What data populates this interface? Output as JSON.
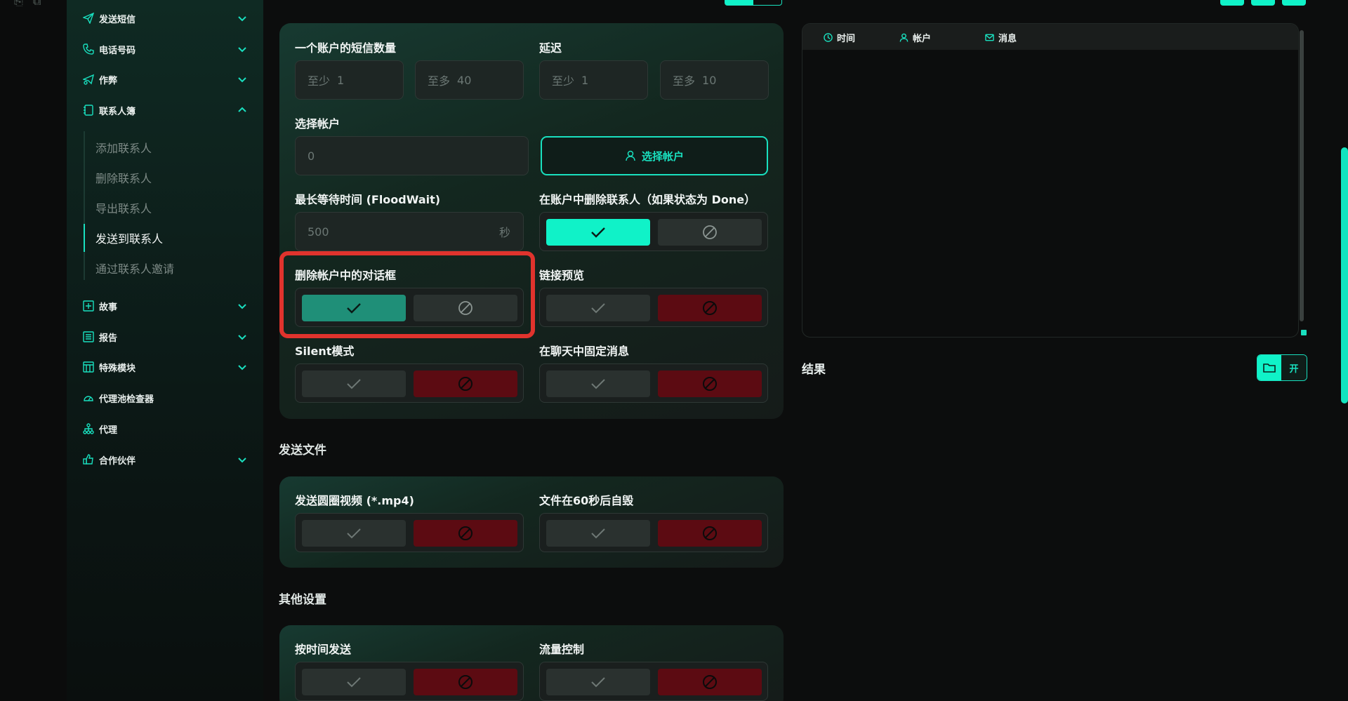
{
  "sidebar": {
    "items": [
      {
        "label": "发送短信",
        "icon": "send-icon"
      },
      {
        "label": "电话号码",
        "icon": "phone-icon"
      },
      {
        "label": "作弊",
        "icon": "paper-plane-icon"
      },
      {
        "label": "联系人簿",
        "icon": "contacts-book-icon"
      },
      {
        "label": "故事",
        "icon": "plus-square-icon"
      },
      {
        "label": "报告",
        "icon": "report-icon"
      },
      {
        "label": "特殊模块",
        "icon": "module-icon"
      },
      {
        "label": "代理池检查器",
        "icon": "gauge-icon"
      },
      {
        "label": "代理",
        "icon": "network-icon"
      },
      {
        "label": "合作伙伴",
        "icon": "thumb-icon"
      }
    ],
    "sub_items": [
      "添加联系人",
      "删除联系人",
      "导出联系人",
      "发送到联系人",
      "通过联系人邀请"
    ],
    "active_sub": "发送到联系人"
  },
  "settings": {
    "sms_count_label": "一个账户的短信数量",
    "min_prefix": "至少",
    "max_prefix": "至多",
    "sms_min": "1",
    "sms_max": "40",
    "delay_label": "延迟",
    "delay_min": "1",
    "delay_max": "10",
    "select_account_label": "选择帐户",
    "account_value": "0",
    "select_account_button": "选择帐户",
    "floodwait_label": "最长等待时间 (FloodWait)",
    "floodwait_value": "500",
    "floodwait_unit": "秒",
    "delete_contacts_label": "在账户中删除联系人（如果状态为 Done）",
    "delete_dialogs_label": "删除帐户中的对话框",
    "link_preview_label": "链接预览",
    "silent_label": "Silent模式",
    "pin_label": "在聊天中固定消息"
  },
  "send_files": {
    "title": "发送文件",
    "round_video_label": "发送圆圈视频 (*.mp4)",
    "self_destruct_label": "文件在60秒后自毁"
  },
  "other": {
    "title": "其他设置",
    "schedule_label": "按时间发送",
    "traffic_label": "流量控制"
  },
  "log": {
    "col_time": "时间",
    "col_account": "帐户",
    "col_message": "消息"
  },
  "result": {
    "label": "结果",
    "open_button": "开"
  },
  "colors": {
    "accent": "#10f2c8",
    "accent_dark": "#1f8f78",
    "danger": "#5c0b12",
    "highlight": "#e0332d"
  }
}
